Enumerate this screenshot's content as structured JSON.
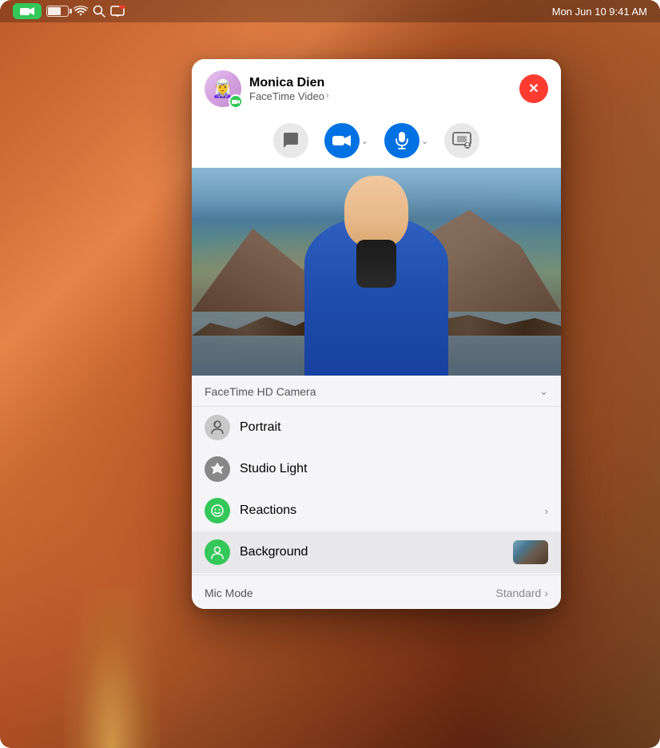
{
  "desktop": {
    "border_radius": "14px"
  },
  "menubar": {
    "app_icon_label": "FaceTime",
    "battery_level": 65,
    "datetime": "Mon Jun 10  9:41 AM"
  },
  "facetime": {
    "caller_name": "Monica Dien",
    "caller_type": "FaceTime Video",
    "close_button_label": "✕",
    "controls": {
      "video_button_label": "Video",
      "mic_button_label": "Mic",
      "screen_share_label": "Screen Share"
    },
    "camera_dropdown": {
      "camera_name": "FaceTime HD Camera",
      "items": [
        {
          "id": "portrait",
          "label": "Portrait",
          "icon": "f",
          "icon_style": "gray",
          "has_chevron": false
        },
        {
          "id": "studio-light",
          "label": "Studio Light",
          "icon": "cube",
          "icon_style": "dark-gray",
          "has_chevron": false
        },
        {
          "id": "reactions",
          "label": "Reactions",
          "icon": "Q",
          "icon_style": "green",
          "has_chevron": true
        },
        {
          "id": "background",
          "label": "Background",
          "icon": "person",
          "icon_style": "green",
          "has_chevron": false,
          "has_thumb": true,
          "highlighted": true
        }
      ]
    },
    "mic_mode": {
      "label": "Mic Mode",
      "value": "Standard"
    }
  }
}
